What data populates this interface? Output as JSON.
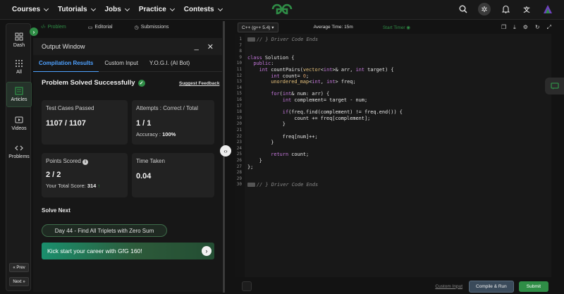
{
  "nav": {
    "items": [
      "Courses",
      "Tutorials",
      "Jobs",
      "Practice",
      "Contests"
    ],
    "logo": "GfG"
  },
  "sidebar": {
    "items": [
      {
        "label": "Dash",
        "icon": "dashboard-icon"
      },
      {
        "label": "All",
        "icon": "grid-icon"
      },
      {
        "label": "Articles",
        "icon": "articles-icon"
      },
      {
        "label": "Videos",
        "icon": "video-icon"
      },
      {
        "label": "Problems",
        "icon": "code-icon"
      }
    ],
    "prev": "« Prev",
    "next": "Next »"
  },
  "problem_tabs": [
    "Problem",
    "Editorial",
    "Submissions"
  ],
  "output": {
    "title": "Output Window",
    "tabs": [
      "Compilation Results",
      "Custom Input",
      "Y.O.G.I. (AI Bot)"
    ],
    "status": "Problem Solved Successfully",
    "feedback": "Suggest Feedback",
    "cards": {
      "tests": {
        "label": "Test Cases Passed",
        "value": "1107 / 1107"
      },
      "attempts": {
        "label": "Attempts : Correct / Total",
        "value": "1 / 1",
        "sub_label": "Accuracy :",
        "sub_value": "100%"
      },
      "points": {
        "label": "Points Scored",
        "value": "2 / 2",
        "sub_label": "Your Total Score:",
        "sub_value": "314"
      },
      "time": {
        "label": "Time Taken",
        "value": "0.04"
      }
    },
    "solve_next": "Solve Next",
    "next_problem": "Day 44 - Find All Triplets with Zero Sum",
    "banner": "Kick start your career with GfG 160!"
  },
  "editor": {
    "language": "C++ (g++ 5.4)",
    "avg_time": "Average Time: 15m",
    "timer": "Start Timer",
    "lines": [
      {
        "n": "1",
        "t": "// } Driver Code Ends",
        "cls": "cm",
        "fold": true
      },
      {
        "n": "7",
        "t": ""
      },
      {
        "n": "8",
        "t": ""
      },
      {
        "n": "9",
        "t": "class Solution {"
      },
      {
        "n": "10",
        "t": "  public:"
      },
      {
        "n": "11",
        "t": "    int countPairs(vector<int>& arr, int target) {"
      },
      {
        "n": "12",
        "t": "        int count= 0;"
      },
      {
        "n": "13",
        "t": "        unordered_map<int, int> freq;"
      },
      {
        "n": "14",
        "t": ""
      },
      {
        "n": "15",
        "t": "        for(int& num: arr) {"
      },
      {
        "n": "16",
        "t": "            int complement= target - num;"
      },
      {
        "n": "17",
        "t": ""
      },
      {
        "n": "18",
        "t": "            if(freq.find(complement) != freq.end()) {"
      },
      {
        "n": "19",
        "t": "                count += freq[complement];"
      },
      {
        "n": "20",
        "t": "            }"
      },
      {
        "n": "21",
        "t": ""
      },
      {
        "n": "22",
        "t": "            freq[num]++;"
      },
      {
        "n": "23",
        "t": "        }"
      },
      {
        "n": "24",
        "t": ""
      },
      {
        "n": "25",
        "t": "        return count;"
      },
      {
        "n": "26",
        "t": "    }"
      },
      {
        "n": "27",
        "t": "};"
      },
      {
        "n": "28",
        "t": ""
      },
      {
        "n": "29",
        "t": ""
      },
      {
        "n": "30",
        "t": "// } Driver Code Ends",
        "cls": "cm",
        "fold": true
      }
    ]
  },
  "bottom": {
    "custom_input": "Custom Input",
    "compile": "Compile & Run",
    "submit": "Submit"
  }
}
